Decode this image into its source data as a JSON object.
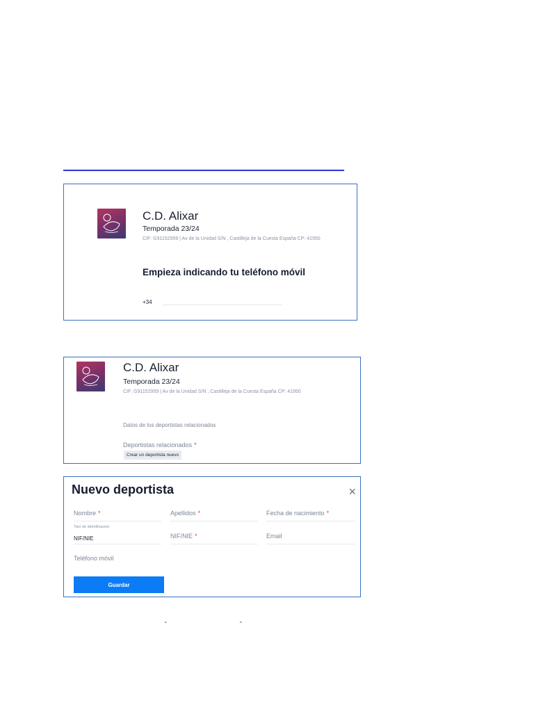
{
  "club": {
    "name": "C.D. Alixar",
    "season": "Temporada 23/24",
    "cif": "CIF: G91152959 | Av de la Unidad S/N , Castilleja de la Cuesta España CP: 41950"
  },
  "step1": {
    "heading": "Empieza indicando tu teléfono móvil",
    "phone_prefix": "+34"
  },
  "step2": {
    "section_label": "Datos de los deportistas relacionados",
    "related_label": "Deportistas relacionados",
    "required_mark": "*",
    "create_button": "Crear un deportista nuevo"
  },
  "modal": {
    "title": "Nuevo deportista",
    "close_glyph": "×",
    "fields": {
      "nombre": "Nombre",
      "apellidos": "Apellidos",
      "fecha": "Fecha de nacimiento",
      "tipo_id_label": "Tipo de identificación",
      "tipo_id_value": "NIF/NIE",
      "nif": "NIF/NIE",
      "email": "Email",
      "telefono": "Teléfono móvil"
    },
    "required_mark": "*",
    "save_button": "Guardar"
  },
  "footer": {
    "open_quote": "“",
    "close_quote": "”"
  },
  "colors": {
    "accent": "#0b7cf5",
    "panel_border": "#3a6fc2",
    "required": "#e0413b"
  }
}
